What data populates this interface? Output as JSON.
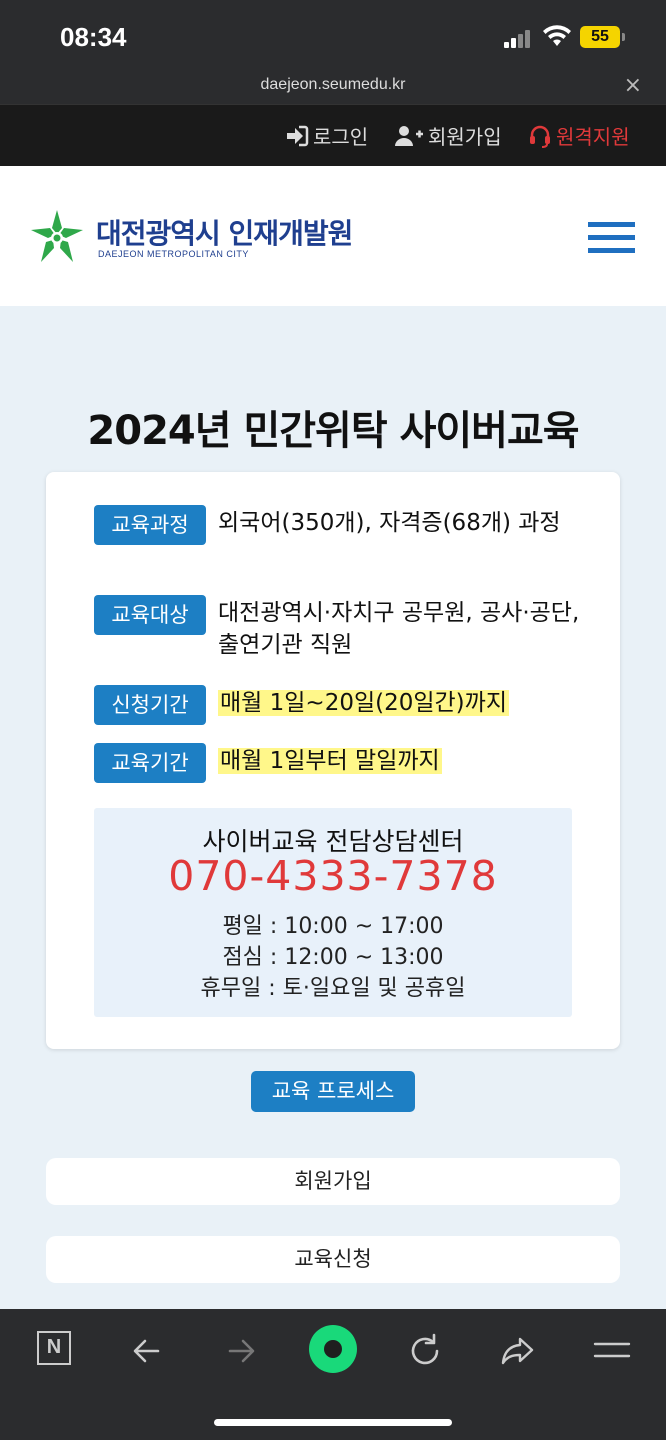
{
  "status": {
    "time": "08:34",
    "battery": "55"
  },
  "browser": {
    "url": "daejeon.seumedu.kr",
    "close": "×"
  },
  "toplinks": {
    "login": "로그인",
    "signup": "회원가입",
    "remote": "원격지원"
  },
  "header": {
    "title": "대전광역시 인재개발원",
    "subtitle": "DAEJEON METROPOLITAN CITY"
  },
  "main": {
    "title": "2024년 민간위탁 사이버교육",
    "info": [
      {
        "label": "교육과정",
        "text": "외국어(350개), 자격증(68개) 과정"
      },
      {
        "label": "교육대상",
        "text": "대전광역시·자치구 공무원, 공사·공단, 출연기관 직원"
      },
      {
        "label": "신청기간",
        "text": "매월 1일~20일(20일간)까지"
      },
      {
        "label": "교육기간",
        "text": "매월 1일부터 말일까지"
      }
    ],
    "contact": {
      "title": "사이버교육 전담상담센터",
      "phone": "070-4333-7378",
      "weekday": "평일 : 10:00 ~ 17:00",
      "lunch": "점심 : 12:00 ~ 13:00",
      "holiday": "휴무일 : 토·일요일 및 공휴일"
    },
    "process_label": "교육 프로세스",
    "steps": [
      "회원가입",
      "교육신청"
    ]
  },
  "colors": {
    "accent": "#1d7fc4",
    "phone": "#e0393a",
    "highlight": "#fff78a",
    "brand": "#1f3f8f"
  },
  "icons": {
    "login": "sign-in-icon",
    "signup": "user-plus-icon",
    "remote": "headset-icon",
    "menu": "hamburger-icon",
    "naver": "n-logo-icon",
    "back": "arrow-left-icon",
    "forward": "arrow-right-icon",
    "home": "green-dot-icon",
    "reload": "reload-icon",
    "share": "share-icon",
    "more": "menu-icon"
  }
}
